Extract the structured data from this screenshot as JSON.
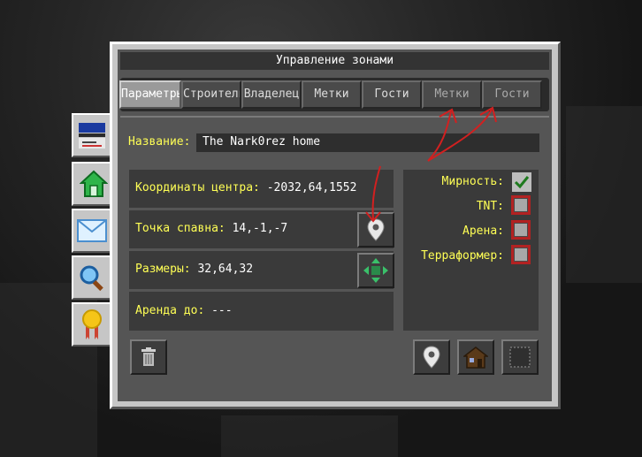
{
  "dialog": {
    "title": "Управление зонами"
  },
  "tabs": [
    {
      "label": "Параметры",
      "active": true
    },
    {
      "label": "Строители",
      "active": false
    },
    {
      "label": "Владелец",
      "active": false
    },
    {
      "label": "Метки",
      "active": false
    },
    {
      "label": "Гости",
      "active": false
    },
    {
      "label": "Метки",
      "active": false
    },
    {
      "label": "Гости",
      "active": false
    }
  ],
  "zone": {
    "name_label": "Название:",
    "name_value": "The Nark0rez home",
    "center_label": "Координаты центра:",
    "center_value": "-2032,64,1552",
    "spawn_label": "Точка спавна:",
    "spawn_value": "14,-1,-7",
    "size_label": "Размеры:",
    "size_value": "32,64,32",
    "rent_label": "Аренда до:",
    "rent_value": "---"
  },
  "flags": [
    {
      "label": "Мирность:",
      "checked": true
    },
    {
      "label": "TNT:",
      "checked": false
    },
    {
      "label": "Арена:",
      "checked": false
    },
    {
      "label": "Терраформер:",
      "checked": false
    }
  ],
  "side_tabs": [
    "id-card-icon",
    "home-icon",
    "mail-icon",
    "search-icon",
    "medal-icon"
  ],
  "colors": {
    "label_yellow": "#ffff55",
    "annotation_red": "#d22020",
    "checkbox_highlight": "#b22222"
  }
}
